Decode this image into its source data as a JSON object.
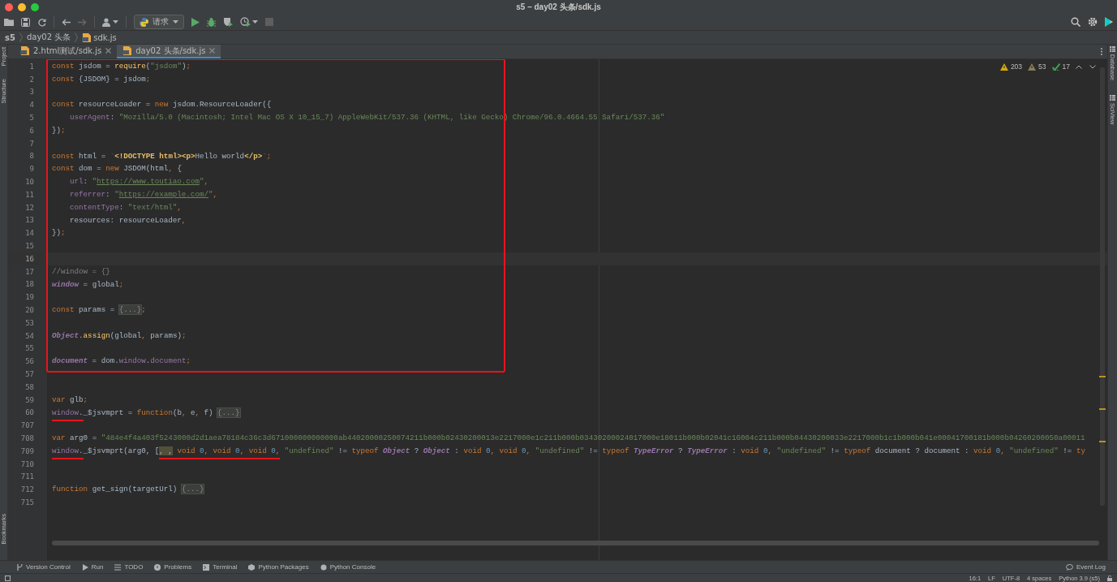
{
  "window": {
    "title": "s5 – day02 头条/sdk.js"
  },
  "toolbar": {
    "run_config": "请求"
  },
  "breadcrumbs": [
    {
      "label": "s5",
      "kind": "project"
    },
    {
      "label": "day02 头条",
      "kind": "folder"
    },
    {
      "label": "sdk.js",
      "kind": "file"
    }
  ],
  "left_tools": [
    {
      "label": "Project",
      "kind": "top"
    },
    {
      "label": "Structure",
      "kind": "top"
    },
    {
      "label": "Bookmarks",
      "kind": "bottom"
    }
  ],
  "right_tools": [
    {
      "label": "Database"
    },
    {
      "label": "SciView"
    }
  ],
  "tabs": [
    {
      "label": "2.html测试/sdk.js",
      "selected": false
    },
    {
      "label": "day02 头条/sdk.js",
      "selected": true
    }
  ],
  "inspections": [
    {
      "kind": "error",
      "count": "203"
    },
    {
      "kind": "warning",
      "count": "53"
    },
    {
      "kind": "typo",
      "count": "17"
    }
  ],
  "editor": {
    "blocks": [
      {
        "kind": "framed",
        "lines": [
          {
            "number": "1",
            "current": false,
            "kind": "plain",
            "tokens": [
              {
                "kind": "kw",
                "text": "const "
              },
              {
                "kind": "id",
                "text": "jsdom = "
              },
              {
                "kind": "fn",
                "text": "require"
              },
              {
                "kind": "id",
                "text": "("
              },
              {
                "kind": "str",
                "text": "\"jsdom\""
              },
              {
                "kind": "id",
                "text": ")"
              },
              {
                "kind": "kw",
                "text": ";"
              }
            ]
          },
          {
            "number": "2",
            "current": false,
            "kind": "plain",
            "tokens": [
              {
                "kind": "kw",
                "text": "const "
              },
              {
                "kind": "id",
                "text": "{JSDOM} = jsdom"
              },
              {
                "kind": "kw",
                "text": ";"
              }
            ]
          },
          {
            "number": "3",
            "current": false,
            "kind": "plain"
          },
          {
            "number": "4",
            "current": false,
            "kind": "plain",
            "tokens": [
              {
                "kind": "kw",
                "text": "const "
              },
              {
                "kind": "id",
                "text": "resourceLoader = "
              },
              {
                "kind": "kw",
                "text": "new "
              },
              {
                "kind": "id",
                "text": "jsdom.ResourceLoader({"
              }
            ]
          },
          {
            "number": "5",
            "current": false,
            "kind": "indented",
            "tokens": [
              {
                "kind": "prop",
                "text": "userAgent"
              },
              {
                "kind": "id",
                "text": ": "
              },
              {
                "kind": "str",
                "text": "\"Mozilla/5.0 (Macintosh; Intel Mac OS X 10_15_7) AppleWebKit/537.36 (KHTML, like Gecko) Chrome/96.0.4664.55 Safari/537.36\""
              }
            ]
          },
          {
            "number": "6",
            "current": false,
            "kind": "plain",
            "tokens": [
              {
                "kind": "id",
                "text": "})"
              },
              {
                "kind": "kw",
                "text": ";"
              }
            ]
          },
          {
            "number": "7",
            "current": false,
            "kind": "plain"
          },
          {
            "number": "8",
            "current": false,
            "kind": "plain",
            "tokens": [
              {
                "kind": "kw",
                "text": "const "
              },
              {
                "kind": "id",
                "text": "html = "
              },
              {
                "kind": "str",
                "text": "`"
              },
              {
                "kind": "tag",
                "text": "<!DOCTYPE html><p>"
              },
              {
                "kind": "id",
                "text": "Hello world"
              },
              {
                "kind": "tag",
                "text": "</p>"
              },
              {
                "kind": "str",
                "text": "`"
              },
              {
                "kind": "kw",
                "text": ";"
              }
            ]
          },
          {
            "number": "9",
            "current": false,
            "kind": "plain",
            "tokens": [
              {
                "kind": "kw",
                "text": "const "
              },
              {
                "kind": "id",
                "text": "dom = "
              },
              {
                "kind": "kw",
                "text": "new "
              },
              {
                "kind": "id",
                "text": "JSDOM(html"
              },
              {
                "kind": "kw",
                "text": ", "
              },
              {
                "kind": "id",
                "text": "{"
              }
            ]
          },
          {
            "number": "10",
            "current": false,
            "kind": "indented",
            "tokens": [
              {
                "kind": "prop",
                "text": "url"
              },
              {
                "kind": "id",
                "text": ": "
              },
              {
                "kind": "str",
                "text": "\""
              },
              {
                "kind": "url",
                "text": "https://www.toutiao.com"
              },
              {
                "kind": "str",
                "text": "\""
              },
              {
                "kind": "kw",
                "text": ","
              }
            ]
          },
          {
            "number": "11",
            "current": false,
            "kind": "indented",
            "tokens": [
              {
                "kind": "prop",
                "text": "referrer"
              },
              {
                "kind": "id",
                "text": ": "
              },
              {
                "kind": "str",
                "text": "\""
              },
              {
                "kind": "url",
                "text": "https://example.com/"
              },
              {
                "kind": "str",
                "text": "\""
              },
              {
                "kind": "kw",
                "text": ","
              }
            ]
          },
          {
            "number": "12",
            "current": false,
            "kind": "indented",
            "tokens": [
              {
                "kind": "prop",
                "text": "contentType"
              },
              {
                "kind": "id",
                "text": ": "
              },
              {
                "kind": "str",
                "text": "\"text/html\""
              },
              {
                "kind": "kw",
                "text": ","
              }
            ]
          },
          {
            "number": "13",
            "current": false,
            "kind": "indented",
            "tokens": [
              {
                "kind": "id",
                "text": "resources: resourceLoader"
              },
              {
                "kind": "kw",
                "text": ","
              }
            ]
          },
          {
            "number": "14",
            "current": false,
            "kind": "plain",
            "tokens": [
              {
                "kind": "id",
                "text": "})"
              },
              {
                "kind": "kw",
                "text": ";"
              }
            ]
          },
          {
            "number": "15",
            "current": false,
            "kind": "plain"
          },
          {
            "number": "16",
            "current": true,
            "kind": "plain"
          },
          {
            "number": "17",
            "current": false,
            "kind": "plain",
            "tokens": [
              {
                "kind": "cm",
                "text": "//window = {}"
              }
            ]
          },
          {
            "number": "18",
            "current": false,
            "kind": "plain",
            "tokens": [
              {
                "kind": "gl",
                "text": "window"
              },
              {
                "kind": "id",
                "text": " = global"
              },
              {
                "kind": "kw",
                "text": ";"
              }
            ]
          },
          {
            "number": "19",
            "current": false,
            "kind": "plain"
          },
          {
            "number": "20",
            "current": false,
            "kind": "plain",
            "tokens": [
              {
                "kind": "kw",
                "text": "const "
              },
              {
                "kind": "id",
                "text": "params = "
              },
              {
                "kind": "fold",
                "text": "{...}"
              },
              {
                "kind": "kw",
                "text": ";"
              }
            ]
          },
          {
            "number": "53",
            "current": false,
            "kind": "plain"
          },
          {
            "number": "54",
            "current": false,
            "kind": "plain",
            "tokens": [
              {
                "kind": "gl",
                "text": "Object"
              },
              {
                "kind": "id",
                "text": "."
              },
              {
                "kind": "fn",
                "text": "assign"
              },
              {
                "kind": "id",
                "text": "(global"
              },
              {
                "kind": "kw",
                "text": ", "
              },
              {
                "kind": "id",
                "text": "params)"
              },
              {
                "kind": "kw",
                "text": ";"
              }
            ]
          },
          {
            "number": "55",
            "current": false,
            "kind": "plain"
          },
          {
            "number": "56",
            "current": false,
            "kind": "plain",
            "tokens": [
              {
                "kind": "gl",
                "text": "document"
              },
              {
                "kind": "id",
                "text": " = dom."
              },
              {
                "kind": "prop",
                "text": "window"
              },
              {
                "kind": "id",
                "text": "."
              },
              {
                "kind": "prop",
                "text": "document"
              },
              {
                "kind": "kw",
                "text": ";"
              }
            ]
          }
        ]
      },
      {
        "kind": "plain",
        "lines": [
          {
            "number": "57",
            "current": false,
            "kind": "plain"
          },
          {
            "number": "58",
            "current": false,
            "kind": "plain"
          },
          {
            "number": "59",
            "current": false,
            "kind": "plain",
            "tokens": [
              {
                "kind": "kw",
                "text": "var "
              },
              {
                "kind": "id",
                "text": "glb"
              },
              {
                "kind": "kw",
                "text": ";"
              }
            ]
          },
          {
            "number": "60",
            "current": false,
            "kind": "plain",
            "tokens": [
              {
                "kind": "annotated",
                "parts": [
                  {
                    "kind": "prop",
                    "text": "window"
                  },
                  {
                    "kind": "id",
                    "text": "."
                  }
                ]
              },
              {
                "kind": "id",
                "text": "_$jsvmprt = "
              },
              {
                "kind": "kw",
                "text": "function"
              },
              {
                "kind": "id",
                "text": "(b"
              },
              {
                "kind": "kw",
                "text": ", "
              },
              {
                "kind": "id",
                "text": "e"
              },
              {
                "kind": "kw",
                "text": ", "
              },
              {
                "kind": "id",
                "text": "f) "
              },
              {
                "kind": "fold",
                "text": "{...}"
              }
            ]
          },
          {
            "number": "707",
            "current": false,
            "kind": "plain"
          },
          {
            "number": "708",
            "current": false,
            "kind": "plain",
            "tokens": [
              {
                "kind": "kw",
                "text": "var "
              },
              {
                "kind": "id",
                "text": "arg0 = "
              },
              {
                "kind": "str",
                "text": "\"484e4f4a403f5243000d2d1aea78184c36c3d671000000000000ab44020000250074211b000b02430200013e2217000e1c211b000b03430200024017000e18011b000b02041c16004c211b000b04430200033e2217000b1c1b000b041e00041700181b000b04260200050a00011"
              }
            ]
          },
          {
            "number": "709",
            "current": false,
            "kind": "plain",
            "tokens": [
              {
                "kind": "annotated",
                "parts": [
                  {
                    "kind": "prop",
                    "text": "window"
                  },
                  {
                    "kind": "id",
                    "text": "."
                  }
                ]
              },
              {
                "kind": "id",
                "text": "_$jsvmprt(arg0, ["
              },
              {
                "kind": "annotated",
                "parts": [
                  {
                    "kind": "warn",
                    "text": ", ,"
                  },
                  {
                    "kind": "kw",
                    "text": " void "
                  },
                  {
                    "kind": "num",
                    "text": "0"
                  },
                  {
                    "kind": "kw",
                    "text": ", void "
                  },
                  {
                    "kind": "num",
                    "text": "0"
                  },
                  {
                    "kind": "kw",
                    "text": ", void "
                  },
                  {
                    "kind": "num",
                    "text": "0"
                  },
                  {
                    "kind": "kw",
                    "text": ","
                  }
                ]
              },
              {
                "kind": "str",
                "text": " \"undefined\""
              },
              {
                "kind": "id",
                "text": " != "
              },
              {
                "kind": "kw",
                "text": "typeof "
              },
              {
                "kind": "gl",
                "text": "Object"
              },
              {
                "kind": "id",
                "text": " ? "
              },
              {
                "kind": "gl",
                "text": "Object"
              },
              {
                "kind": "id",
                "text": " : "
              },
              {
                "kind": "kw",
                "text": "void "
              },
              {
                "kind": "num",
                "text": "0"
              },
              {
                "kind": "kw",
                "text": ", void "
              },
              {
                "kind": "num",
                "text": "0"
              },
              {
                "kind": "kw",
                "text": ", "
              },
              {
                "kind": "str",
                "text": "\"undefined\""
              },
              {
                "kind": "id",
                "text": " != "
              },
              {
                "kind": "kw",
                "text": "typeof "
              },
              {
                "kind": "gl",
                "text": "TypeError"
              },
              {
                "kind": "id",
                "text": " ? "
              },
              {
                "kind": "gl",
                "text": "TypeError"
              },
              {
                "kind": "id",
                "text": " : "
              },
              {
                "kind": "kw",
                "text": "void "
              },
              {
                "kind": "num",
                "text": "0"
              },
              {
                "kind": "kw",
                "text": ", "
              },
              {
                "kind": "str",
                "text": "\"undefined\""
              },
              {
                "kind": "id",
                "text": " != "
              },
              {
                "kind": "kw",
                "text": "typeof "
              },
              {
                "kind": "id",
                "text": "document ? document : "
              },
              {
                "kind": "kw",
                "text": "void "
              },
              {
                "kind": "num",
                "text": "0"
              },
              {
                "kind": "kw",
                "text": ", "
              },
              {
                "kind": "str",
                "text": "\"undefined\""
              },
              {
                "kind": "id",
                "text": " != "
              },
              {
                "kind": "kw",
                "text": "ty"
              }
            ]
          },
          {
            "number": "710",
            "current": false,
            "kind": "plain"
          },
          {
            "number": "711",
            "current": false,
            "kind": "plain"
          },
          {
            "number": "712",
            "current": false,
            "kind": "plain",
            "tokens": [
              {
                "kind": "kw",
                "text": "function "
              },
              {
                "kind": "id",
                "text": "get_sign(targetUrl) "
              },
              {
                "kind": "fold",
                "text": "{...}"
              }
            ]
          },
          {
            "number": "715",
            "current": false,
            "kind": "plain"
          }
        ]
      }
    ]
  },
  "bottom_tools": [
    {
      "label": "Version Control",
      "kind": "vcs"
    },
    {
      "label": "Run",
      "kind": "run"
    },
    {
      "label": "TODO",
      "kind": "todo"
    },
    {
      "label": "Problems",
      "kind": "problems"
    },
    {
      "label": "Terminal",
      "kind": "terminal"
    },
    {
      "label": "Python Packages",
      "kind": "packages"
    },
    {
      "label": "Python Console",
      "kind": "console"
    }
  ],
  "event_log": "Event Log",
  "status_bar": [
    "16:1",
    "LF",
    "UTF-8",
    "4 spaces",
    "Python 3.9 (s5)"
  ]
}
